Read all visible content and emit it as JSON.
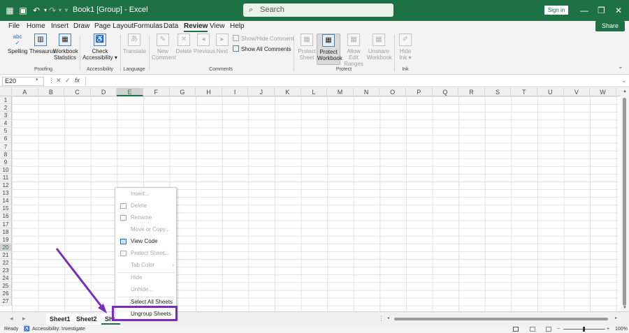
{
  "titlebar": {
    "title": "Book1 [Group] - Excel",
    "search_placeholder": "Search",
    "sign_in": "Sign in"
  },
  "menu": {
    "tabs": [
      "File",
      "Home",
      "Insert",
      "Draw",
      "Page Layout",
      "Formulas",
      "Data",
      "Review",
      "View",
      "Help"
    ],
    "share": "Share"
  },
  "ribbon": {
    "proofing": {
      "spelling": "Spelling",
      "thesaurus": "Thesaurus",
      "workbook_stats_1": "Workbook",
      "workbook_stats_2": "Statistics",
      "group": "Proofing"
    },
    "accessibility": {
      "check_1": "Check",
      "check_2": "Accessibility",
      "group": "Accessibility"
    },
    "language": {
      "translate": "Translate",
      "group": "Language"
    },
    "comments": {
      "new_1": "New",
      "new_2": "Comment",
      "delete": "Delete",
      "previous": "Previous",
      "next": "Next",
      "show_hide": "Show/Hide Comment",
      "show_all": "Show All Comments",
      "group": "Comments"
    },
    "protect": {
      "sheet_1": "Protect",
      "sheet_2": "Sheet",
      "workbook_1": "Protect",
      "workbook_2": "Workbook",
      "ranges_1": "Allow Edit",
      "ranges_2": "Ranges",
      "unshare_1": "Unshare",
      "unshare_2": "Workbook",
      "group": "Protect"
    },
    "ink": {
      "hide_1": "Hide",
      "hide_2": "Ink",
      "group": "Ink"
    },
    "spelling_abc": "abc"
  },
  "formula_bar": {
    "name_box": "E20",
    "fx": "fx"
  },
  "columns": [
    "A",
    "B",
    "C",
    "D",
    "E",
    "F",
    "G",
    "H",
    "I",
    "J",
    "K",
    "L",
    "M",
    "N",
    "O",
    "P",
    "Q",
    "R",
    "S",
    "T",
    "U",
    "V",
    "W"
  ],
  "rows": [
    "1",
    "2",
    "3",
    "4",
    "5",
    "6",
    "7",
    "8",
    "9",
    "10",
    "11",
    "12",
    "13",
    "14",
    "15",
    "16",
    "17",
    "18",
    "19",
    "20",
    "21",
    "22",
    "23",
    "24",
    "25",
    "26",
    "27"
  ],
  "context_menu": {
    "insert": "Insert...",
    "delete": "Delete",
    "rename": "Rename",
    "move_copy": "Move or Copy...",
    "view_code": "View Code",
    "protect_sheet": "Protect Sheet...",
    "tab_color": "Tab Color",
    "hide": "Hide",
    "unhide": "Unhide...",
    "select_all": "Select All Sheets",
    "ungroup": "Ungroup Sheets"
  },
  "sheet_tabs": [
    "Sheet1",
    "Sheet2",
    "She"
  ],
  "statusbar": {
    "ready": "Ready",
    "accessibility": "Accessibility: Investigate",
    "zoom": "100%"
  },
  "colors": {
    "brand": "#1e7145",
    "highlight": "#7b2cbf"
  }
}
